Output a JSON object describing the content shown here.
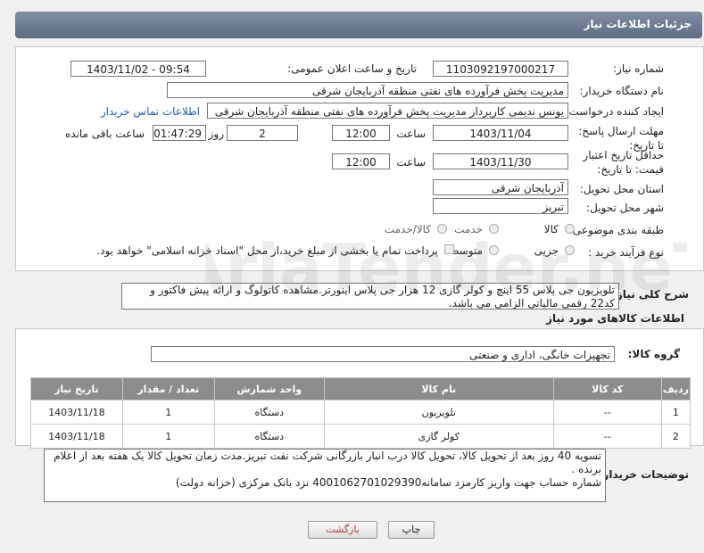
{
  "header": {
    "title": "جزئیات اطلاعات نیاز"
  },
  "form": {
    "need_number_label": "شماره نیاز:",
    "need_number": "1103092197000217",
    "announce_label": "تاریخ و ساعت اعلان عمومی:",
    "announce_value": "1403/11/02 - 09:54",
    "buyer_org_label": "نام دستگاه خریدار:",
    "buyer_org": "مدیریت پخش فرآورده های نفتی منطقه آذربایجان شرقی",
    "requester_label": "ایجاد کننده درخواست:",
    "requester": "یونس ندیمی کاربرداز مدیریت پخش فرآورده های نفتی منطقه آذربایجان شرقی",
    "contact_link": "اطلاعات تماس خریدار",
    "reply_deadline_label": "مهلت ارسال پاسخ: تا تاریخ:",
    "reply_date": "1403/11/04",
    "time_label": "ساعت",
    "reply_time": "12:00",
    "days_value": "2",
    "days_label": "روز و",
    "remaining_value": "01:47:29",
    "remaining_label": "ساعت باقی مانده",
    "price_validity_label": "حداقل تاریخ اعتبار قیمت: تا تاریخ:",
    "price_date": "1403/11/30",
    "price_time": "12:00",
    "province_label": "استان محل تحویل:",
    "province": "آذربایجان شرقی",
    "city_label": "شهر محل تحویل:",
    "city": "تبریز",
    "category_label": "طبقه بندی موضوعی:",
    "category_options": [
      "کالا",
      "خدمت",
      "کالا/خدمت"
    ],
    "purchase_type_label": "نوع فرآیند خرید :",
    "purchase_options": [
      "جزیی",
      "متوسط"
    ],
    "payment_note": "پرداخت تمام یا بخشی از مبلغ خرید،از محل \"اسناد خزانه اسلامی\" خواهد بود."
  },
  "summary": {
    "label": "شرح کلی نیاز:",
    "text": "تلویزیون جی پلاس 55 اینچ و کولر گازی 12 هزار جی پلاس اینورتر.مشاهده کاتولوگ و ارائه پیش فاکتور و کد22 رقمی مالیاتی الزامی می باشد."
  },
  "goods": {
    "section_title": "اطلاعات کالاهای مورد نیاز",
    "group_label": "گروه کالا:",
    "group_value": "تجهیزات خانگی، اداری و صنعتی",
    "columns": [
      "ردیف",
      "کد کالا",
      "نام کالا",
      "واحد شمارش",
      "تعداد / مقدار",
      "تاریخ نیاز"
    ],
    "rows": [
      {
        "row": "1",
        "code": "--",
        "name": "تلویزیون",
        "unit": "دستگاه",
        "qty": "1",
        "date": "1403/11/18"
      },
      {
        "row": "2",
        "code": "--",
        "name": "کولر گازی",
        "unit": "دستگاه",
        "qty": "1",
        "date": "1403/11/18"
      }
    ]
  },
  "buyer_notes": {
    "label": "توضیحات خریدار:",
    "line1": "تسویه 40 روز بعد از تحویل کالا، تحویل کالا درب انبار بازرگانی شرکت نفت تبریز.مدت زمان تحویل کالا یک هفته بعد از اعلام برنده .",
    "line2": "شماره حساب جهت واریز کارمزد سامانه4001062701029390  نزد بانک مرکزی (خزانه دولت)"
  },
  "buttons": {
    "print": "چاپ",
    "back": "بازگشت"
  },
  "watermark": {
    "text": "AriaTender.neT"
  }
}
